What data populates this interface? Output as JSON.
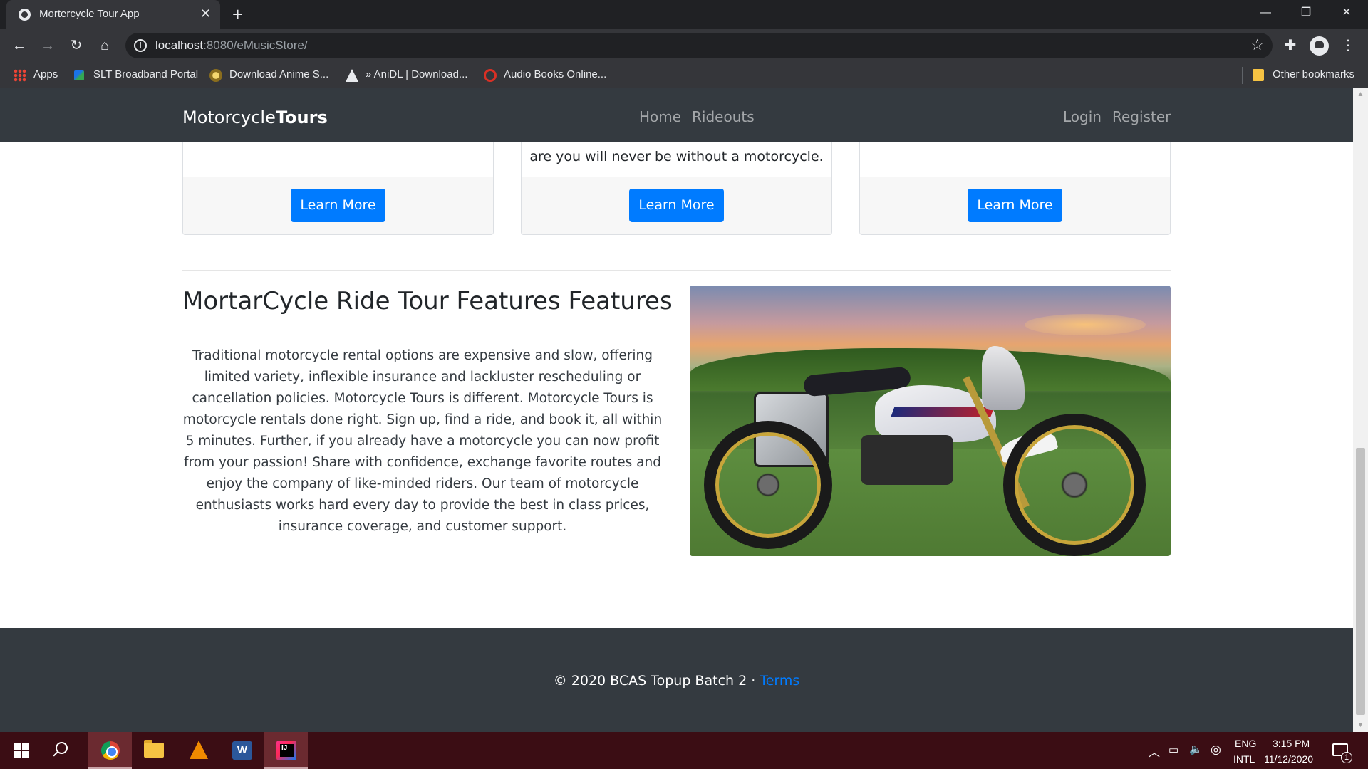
{
  "browser": {
    "tab_title": "Mortercycle Tour App",
    "tab_close": "✕",
    "new_tab": "+",
    "url_host": "localhost",
    "url_path": ":8080/eMusicStore/",
    "window_controls": {
      "minimize": "—",
      "restore": "❐",
      "close": "✕"
    },
    "bookmarks": [
      {
        "label": "Apps",
        "icon": "apps-grid-icon"
      },
      {
        "label": "SLT Broadband Portal",
        "icon": "slt-icon"
      },
      {
        "label": "Download Anime S...",
        "icon": "anime-icon"
      },
      {
        "label": "» AniDL | Download...",
        "icon": "anidl-icon"
      },
      {
        "label": "Audio Books Online...",
        "icon": "audiobook-icon"
      }
    ],
    "other_bookmarks": "Other bookmarks"
  },
  "site": {
    "brand_light": "Motorcycle",
    "brand_bold": "Tours",
    "nav": {
      "home": "Home",
      "rideouts": "Rideouts",
      "login": "Login",
      "register": "Register"
    },
    "cards": [
      {
        "text": "",
        "button": "Learn More"
      },
      {
        "text": "are you will never be without a motorcycle.",
        "button": "Learn More"
      },
      {
        "text": "",
        "button": "Learn More"
      }
    ],
    "feature": {
      "title": "MortarCycle Ride Tour Features Features",
      "body": "Traditional motorcycle rental options are expensive and slow, offering limited variety, inflexible insurance and lackluster rescheduling or cancellation policies. Motorcycle Tours is different. Motorcycle Tours is motorcycle rentals done right. Sign up, find a ride, and book it, all within 5 minutes. Further, if you already have a motorcycle you can now profit from your passion! Share with confidence, exchange favorite routes and enjoy the company of like-minded riders. Our team of motorcycle enthusiasts works hard every day to provide the best in class prices, insurance coverage, and customer support.",
      "image": "adventure-motorcycle-photo"
    },
    "footer": {
      "copyright": "© 2020 BCAS Topup Batch 2 · ",
      "terms": "Terms"
    }
  },
  "taskbar": {
    "apps": [
      "start-icon",
      "search-icon",
      "chrome-icon",
      "file-explorer-icon",
      "vlc-icon",
      "word-icon",
      "intellij-icon"
    ],
    "lang_top": "ENG",
    "lang_bottom": "INTL",
    "time": "3:15 PM",
    "date": "11/12/2020",
    "notification_count": "1"
  },
  "colors": {
    "navbar": "#343a40",
    "primary": "#007bff",
    "taskbar": "#3b0d14"
  }
}
